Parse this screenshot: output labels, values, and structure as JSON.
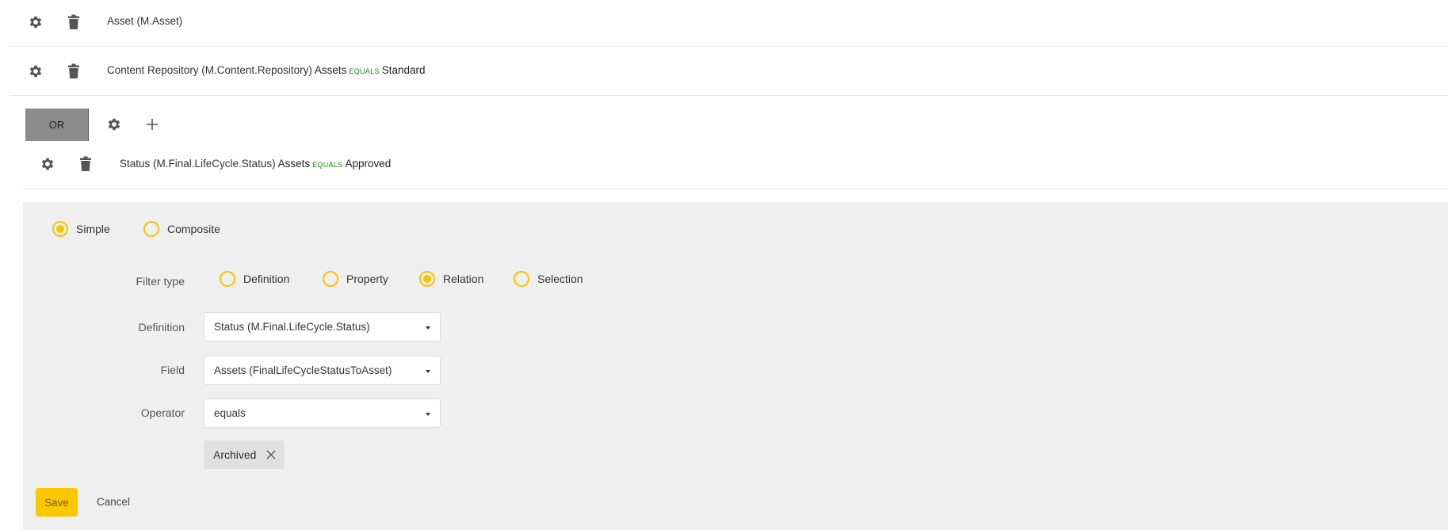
{
  "filters": [
    {
      "settings_icon": "gear-icon",
      "delete_icon": "trash-icon",
      "entity": "Asset (M.Asset)",
      "field": "",
      "operator": "",
      "value": ""
    },
    {
      "settings_icon": "gear-icon",
      "delete_icon": "trash-icon",
      "entity": "Content Repository (M.Content.Repository)",
      "field": "Assets",
      "operator": "EQUALS",
      "value": "Standard"
    }
  ],
  "group": {
    "logic_label": "OR",
    "settings_icon": "gear-icon",
    "add_icon": "plus-icon",
    "filters": [
      {
        "entity": "Status (M.Final.LifeCycle.Status)",
        "field": "Assets",
        "operator": "EQUALS",
        "value": "Approved"
      }
    ]
  },
  "editor": {
    "mode_options": [
      {
        "label": "Simple",
        "checked": true
      },
      {
        "label": "Composite",
        "checked": false
      }
    ],
    "filter_type": {
      "label": "Filter type",
      "options": [
        {
          "label": "Definition",
          "checked": false
        },
        {
          "label": "Property",
          "checked": false
        },
        {
          "label": "Relation",
          "checked": true
        },
        {
          "label": "Selection",
          "checked": false
        }
      ]
    },
    "definition": {
      "label": "Definition",
      "value": "Status (M.Final.LifeCycle.Status)"
    },
    "field": {
      "label": "Field",
      "value": "Assets (FinalLifeCycleStatusToAsset)"
    },
    "operator": {
      "label": "Operator",
      "value": "equals"
    },
    "selected_values": [
      {
        "label": "Archived",
        "remove_icon": "close-icon"
      }
    ],
    "save_label": "Save",
    "cancel_label": "Cancel"
  },
  "colors": {
    "accent": "#fec800",
    "radio": "#f7c300",
    "operator_text": "#118811",
    "panel_bg": "#efefef",
    "or_button_bg": "#8c8c8c"
  }
}
